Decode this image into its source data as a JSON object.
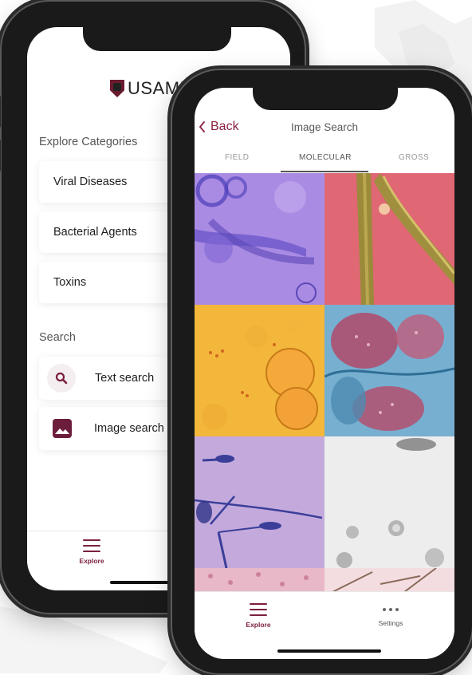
{
  "explore_screen": {
    "explore_categories_title": "Explore Categories",
    "categories": [
      "Viral Diseases",
      "Bacterial Agents",
      "Toxins"
    ],
    "search_title": "Search",
    "text_search_label": "Text search",
    "image_search_label": "Image search",
    "tab_explore_label": "Explore"
  },
  "image_search_screen": {
    "back_label": "Back",
    "title": "Image Search",
    "tabs": [
      "FIELD",
      "MOLECULAR",
      "GROSS"
    ],
    "active_tab": "MOLECULAR",
    "tab_explore_label": "Explore",
    "tab_settings_label": "Settings"
  },
  "colors": {
    "accent": "#7a1f3d",
    "brand": "#6b1b2f"
  }
}
